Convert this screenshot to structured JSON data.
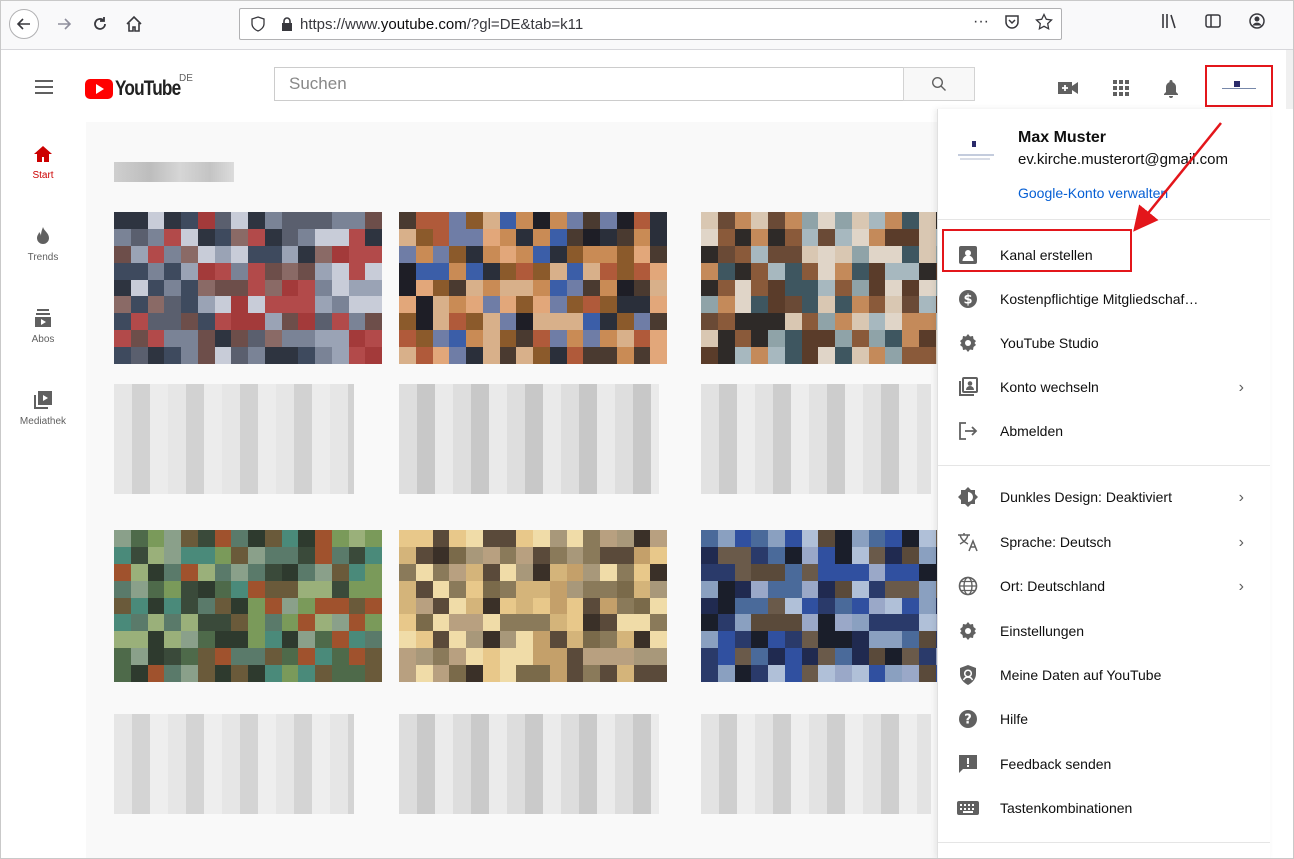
{
  "browser": {
    "url_prefix": "https://www.",
    "url_domain": "youtube.com",
    "url_suffix": "/?gl=DE&tab=k11",
    "more_glyph": "···"
  },
  "header": {
    "logo_text": "YouTube",
    "country_code": "DE",
    "search_placeholder": "Suchen"
  },
  "left_nav": {
    "items": [
      {
        "label": "Start",
        "icon": "home-icon",
        "active": true
      },
      {
        "label": "Trends",
        "icon": "flame-icon",
        "active": false
      },
      {
        "label": "Abos",
        "icon": "subscriptions-icon",
        "active": false
      },
      {
        "label": "Mediathek",
        "icon": "library-icon",
        "active": false
      }
    ]
  },
  "menu": {
    "profile": {
      "name": "Max Muster",
      "email": "ev.kirche.musterort@gmail.com",
      "manage_label": "Google-Konto verwalten"
    },
    "section1": [
      {
        "label": "Kanal erstellen",
        "icon": "person-box-icon",
        "chevron": false
      },
      {
        "label": "Kostenpflichtige Mitgliedschaf…",
        "icon": "dollar-circle-icon",
        "chevron": false
      },
      {
        "label": "YouTube Studio",
        "icon": "gear-icon",
        "chevron": false
      },
      {
        "label": "Konto wechseln",
        "icon": "switch-account-icon",
        "chevron": true
      },
      {
        "label": "Abmelden",
        "icon": "sign-out-icon",
        "chevron": false
      }
    ],
    "section2": [
      {
        "label": "Dunkles Design: Deaktiviert",
        "icon": "dark-theme-icon",
        "chevron": true
      },
      {
        "label": "Sprache: Deutsch",
        "icon": "translate-icon",
        "chevron": true
      },
      {
        "label": "Ort: Deutschland",
        "icon": "globe-icon",
        "chevron": true
      },
      {
        "label": "Einstellungen",
        "icon": "gear-icon",
        "chevron": false
      },
      {
        "label": "Meine Daten auf YouTube",
        "icon": "shield-person-icon",
        "chevron": false
      },
      {
        "label": "Hilfe",
        "icon": "help-icon",
        "chevron": false
      },
      {
        "label": "Feedback senden",
        "icon": "feedback-icon",
        "chevron": false
      },
      {
        "label": "Tastenkombinationen",
        "icon": "keyboard-icon",
        "chevron": false
      }
    ],
    "chevron_glyph": "›"
  },
  "colors": {
    "accent_red": "#ff0000",
    "annotation_red": "#e3161b",
    "link_blue": "#065fd4"
  }
}
